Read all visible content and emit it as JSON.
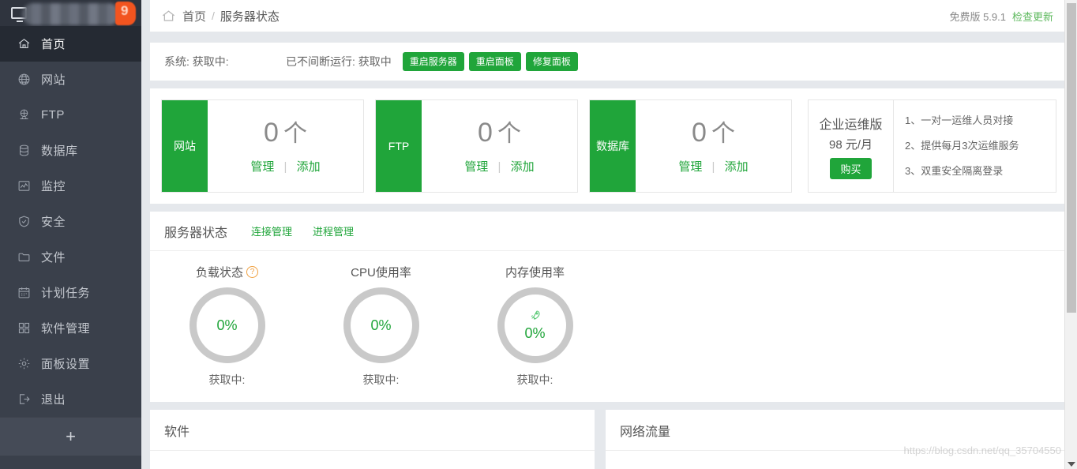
{
  "sidebar": {
    "logo_badge": "9",
    "items": [
      {
        "label": "首页",
        "icon": "home-icon",
        "active": true
      },
      {
        "label": "网站",
        "icon": "globe-icon",
        "active": false
      },
      {
        "label": "FTP",
        "icon": "ftp-icon",
        "active": false
      },
      {
        "label": "数据库",
        "icon": "database-icon",
        "active": false
      },
      {
        "label": "监控",
        "icon": "monitor-icon",
        "active": false
      },
      {
        "label": "安全",
        "icon": "shield-icon",
        "active": false
      },
      {
        "label": "文件",
        "icon": "folder-icon",
        "active": false
      },
      {
        "label": "计划任务",
        "icon": "calendar-icon",
        "active": false
      },
      {
        "label": "软件管理",
        "icon": "grid-icon",
        "active": false
      },
      {
        "label": "面板设置",
        "icon": "gear-icon",
        "active": false
      },
      {
        "label": "退出",
        "icon": "logout-icon",
        "active": false
      }
    ],
    "add_label": "+"
  },
  "breadcrumb": {
    "home_icon": "home-icon",
    "home": "首页",
    "separator": "/",
    "current": "服务器状态",
    "version": "免费版 5.9.1",
    "check_update": "检查更新"
  },
  "system_bar": {
    "system_label": "系统: 获取中:",
    "uptime_label": "已不间断运行: 获取中",
    "buttons": [
      {
        "label": "重启服务器"
      },
      {
        "label": "重启面板"
      },
      {
        "label": "修复面板"
      }
    ]
  },
  "stats": {
    "cards": [
      {
        "tag": "网站",
        "count": "0",
        "unit": "个",
        "manage": "管理",
        "sep": "|",
        "add": "添加"
      },
      {
        "tag": "FTP",
        "count": "0",
        "unit": "个",
        "manage": "管理",
        "sep": "|",
        "add": "添加"
      },
      {
        "tag": "数据库",
        "count": "0",
        "unit": "个",
        "manage": "管理",
        "sep": "|",
        "add": "添加"
      }
    ],
    "promo": {
      "title": "企业运维版",
      "price": "98 元/月",
      "buy_label": "购买",
      "features": [
        "1、一对一运维人员对接",
        "2、提供每月3次运维服务",
        "3、双重安全隔离登录"
      ]
    }
  },
  "server_status": {
    "title": "服务器状态",
    "tabs": [
      {
        "label": "连接管理"
      },
      {
        "label": "进程管理"
      }
    ],
    "gauges": [
      {
        "label": "负载状态",
        "help": "?",
        "percent": "0%",
        "sub": "获取中:",
        "icon": ""
      },
      {
        "label": "CPU使用率",
        "help": "",
        "percent": "0%",
        "sub": "获取中:",
        "icon": ""
      },
      {
        "label": "内存使用率",
        "help": "",
        "percent": "0%",
        "sub": "获取中:",
        "icon": "rocket-icon"
      }
    ]
  },
  "bottom_panels": [
    {
      "title": "软件"
    },
    {
      "title": "网络流量"
    }
  ],
  "watermark": "https://blog.csdn.net/qq_35704550",
  "colors": {
    "brand_green": "#20a53a",
    "sidebar_bg": "#3a404b",
    "sidebar_active": "#252a33",
    "page_bg": "#e5e8ec",
    "badge_orange": "#f2541f"
  }
}
